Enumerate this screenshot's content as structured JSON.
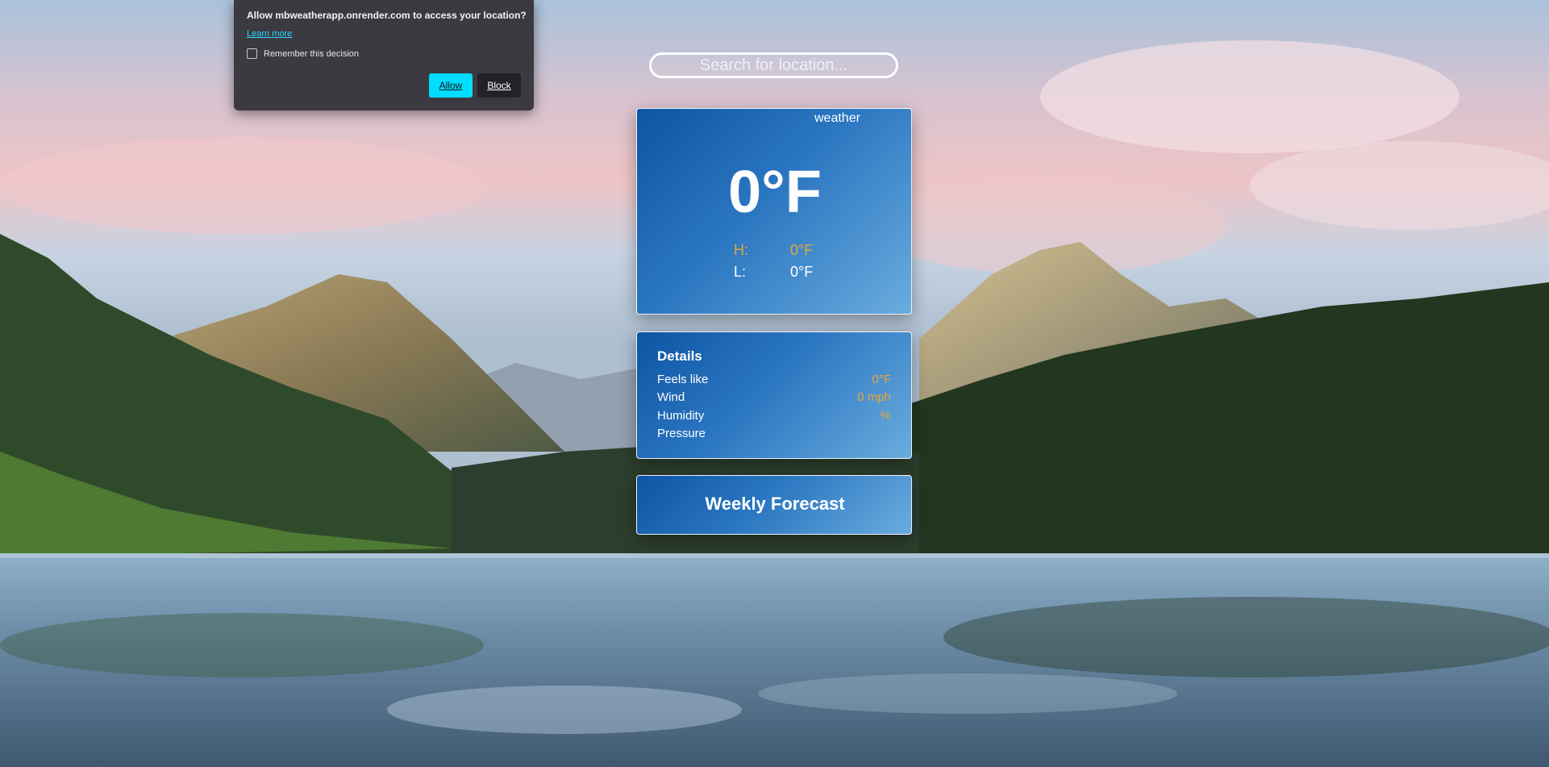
{
  "permission_popup": {
    "message": "Allow mbweatherapp.onrender.com to access your location?",
    "learn_more": "Learn more",
    "remember_label": "Remember this decision",
    "remember_checked": false,
    "allow_label": "Allow",
    "block_label": "Block",
    "allow_color": "#00ddff"
  },
  "search": {
    "placeholder": "Search for location..."
  },
  "current": {
    "condition_label": "weather",
    "temperature": "0°F",
    "high_label": "H:",
    "high_value": "0°F",
    "low_label": "L:",
    "low_value": "0°F"
  },
  "details": {
    "title": "Details",
    "rows": [
      {
        "label": "Feels like",
        "value": "0°F"
      },
      {
        "label": "Wind",
        "value": "0 mph"
      },
      {
        "label": "Humidity",
        "value": "%"
      },
      {
        "label": "Pressure",
        "value": ""
      }
    ]
  },
  "weekly": {
    "label": "Weekly Forecast"
  },
  "colors": {
    "card_gradient_start": "#0e55a3",
    "card_gradient_end": "#6aacde",
    "accent_value": "#e6a735"
  }
}
